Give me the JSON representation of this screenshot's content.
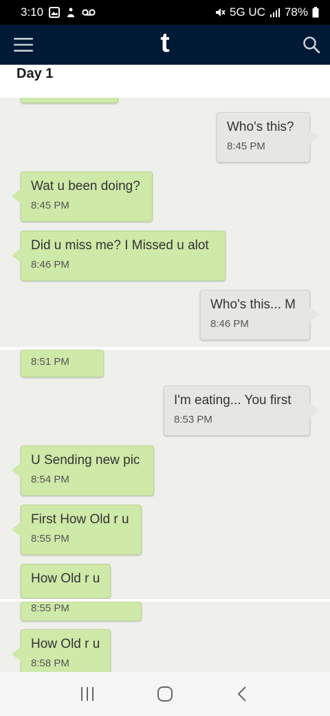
{
  "status_bar": {
    "time": "3:10",
    "network": "5G UC",
    "battery": "78%"
  },
  "app_bar": {
    "logo": "t",
    "menu_icon": "hamburger-menu-icon",
    "search_icon": "search-icon"
  },
  "post": {
    "title": "Day 1"
  },
  "messages": {
    "m1": {
      "text": "Who's this?",
      "time": "8:45 PM"
    },
    "m2": {
      "text": "Wat u been doing?",
      "time": "8:45 PM"
    },
    "m3": {
      "text": "Did u miss me? I Missed u alot",
      "time": "8:46 PM"
    },
    "m4": {
      "text": "Who's this... M",
      "time": "8:46 PM"
    },
    "m5": {
      "time": "8:51 PM"
    },
    "m6": {
      "text": "I'm eating... You first",
      "time": "8:53 PM"
    },
    "m7": {
      "text": "U Sending new pic",
      "time": "8:54 PM"
    },
    "m8": {
      "text": "First How Old r u",
      "time": "8:55 PM"
    },
    "m9": {
      "text": "How Old r u"
    },
    "m10": {
      "time": "8:55 PM"
    },
    "m11": {
      "text": "How Old r u",
      "time": "8:58 PM"
    }
  },
  "colors": {
    "incoming_bubble": "#cfe9a8",
    "outgoing_bubble": "#e6e6e3",
    "chat_background": "#efefeb",
    "app_bar": "#001935"
  }
}
